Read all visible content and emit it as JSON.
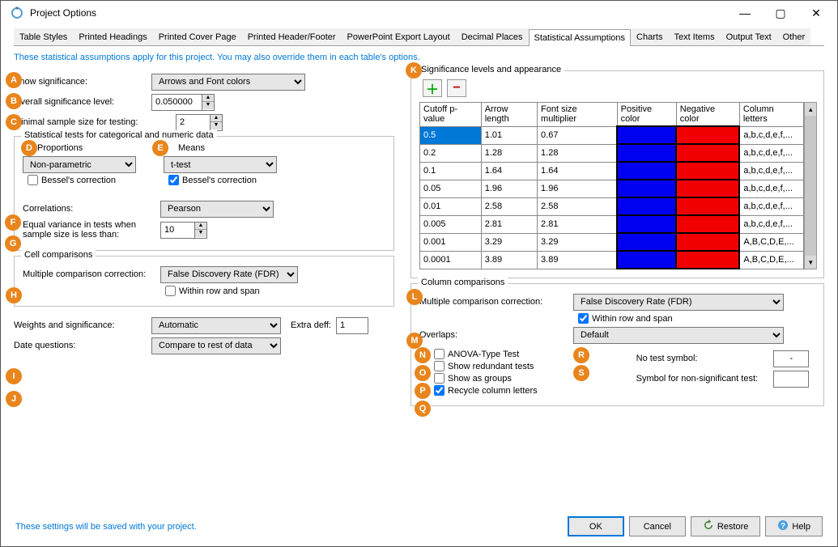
{
  "window": {
    "title": "Project Options"
  },
  "tabs": [
    "Table Styles",
    "Printed Headings",
    "Printed Cover Page",
    "Printed Header/Footer",
    "PowerPoint Export Layout",
    "Decimal Places",
    "Statistical Assumptions",
    "Charts",
    "Text Items",
    "Output Text",
    "Other"
  ],
  "activeTab": "Statistical Assumptions",
  "intro": "These statistical assumptions apply for this project.  You may also override them in each table's options.",
  "left": {
    "showSig": {
      "label": "Show significance:",
      "value": "Arrows and Font colors"
    },
    "overallSig": {
      "label": "Overall significance level:",
      "value": "0.050000"
    },
    "minSample": {
      "label": "Minimal sample size for testing:",
      "value": "2"
    },
    "statTestsLegend": "Statistical tests for categorical and numeric data",
    "proportionsLabel": "Proportions",
    "proportionsValue": "Non-parametric",
    "propBessel": {
      "label": "Bessel's correction",
      "checked": false
    },
    "meansLabel": "Means",
    "meansValue": "t-test",
    "meansBessel": {
      "label": "Bessel's correction",
      "checked": true
    },
    "correlations": {
      "label": "Correlations:",
      "value": "Pearson"
    },
    "equalVar": {
      "label": "Equal variance in tests when sample size is less than:",
      "value": "10"
    },
    "cellCmpLegend": "Cell comparisons",
    "cellMcc": {
      "label": "Multiple comparison correction:",
      "value": "False Discovery Rate (FDR)"
    },
    "cellWithin": {
      "label": "Within row and span",
      "checked": false
    },
    "weights": {
      "label": "Weights and significance:",
      "value": "Automatic"
    },
    "extraDeff": {
      "label": "Extra deff:",
      "value": "1"
    },
    "dateQ": {
      "label": "Date questions:",
      "value": "Compare to rest of data"
    }
  },
  "right": {
    "sigLegend": "Significance levels and appearance",
    "tableHeaders": [
      "Cutoff p-value",
      "Arrow length",
      "Font size multiplier",
      "Positive color",
      "Negative color",
      "Column letters"
    ],
    "rows": [
      {
        "p": "0.5",
        "a": "1.01",
        "f": "0.67",
        "c": "a,b,c,d,e,f,..."
      },
      {
        "p": "0.2",
        "a": "1.28",
        "f": "1.28",
        "c": "a,b,c,d,e,f,..."
      },
      {
        "p": "0.1",
        "a": "1.64",
        "f": "1.64",
        "c": "a,b,c,d,e,f,..."
      },
      {
        "p": "0.05",
        "a": "1.96",
        "f": "1.96",
        "c": "a,b,c,d,e,f,..."
      },
      {
        "p": "0.01",
        "a": "2.58",
        "f": "2.58",
        "c": "a,b,c,d,e,f,..."
      },
      {
        "p": "0.005",
        "a": "2.81",
        "f": "2.81",
        "c": "a,b,c,d,e,f,..."
      },
      {
        "p": "0.001",
        "a": "3.29",
        "f": "3.29",
        "c": "A,B,C,D,E,..."
      },
      {
        "p": "0.0001",
        "a": "3.89",
        "f": "3.89",
        "c": "A,B,C,D,E,..."
      }
    ],
    "colCmpLegend": "Column comparisons",
    "colMcc": {
      "label": "Multiple comparison correction:",
      "value": "False Discovery Rate (FDR)"
    },
    "colWithin": {
      "label": "Within row and span",
      "checked": true
    },
    "overlaps": {
      "label": "Overlaps:",
      "value": "Default"
    },
    "anova": {
      "label": "ANOVA-Type Test",
      "checked": false
    },
    "redund": {
      "label": "Show redundant tests",
      "checked": false
    },
    "groups": {
      "label": "Show as groups",
      "checked": false
    },
    "recycle": {
      "label": "Recycle column letters",
      "checked": true
    },
    "noTest": {
      "label": "No test symbol:",
      "value": "-"
    },
    "nonSig": {
      "label": "Symbol for non-significant test:",
      "value": ""
    }
  },
  "footer": {
    "note": "These settings will be saved with your project.",
    "ok": "OK",
    "cancel": "Cancel",
    "restore": "Restore",
    "help": "Help"
  },
  "badges": {
    "A": "A",
    "B": "B",
    "C": "C",
    "D": "D",
    "E": "E",
    "F": "F",
    "G": "G",
    "H": "H",
    "I": "I",
    "J": "J",
    "K": "K",
    "L": "L",
    "M": "M",
    "N": "N",
    "O": "O",
    "P": "P",
    "Q": "Q",
    "R": "R",
    "S": "S"
  }
}
